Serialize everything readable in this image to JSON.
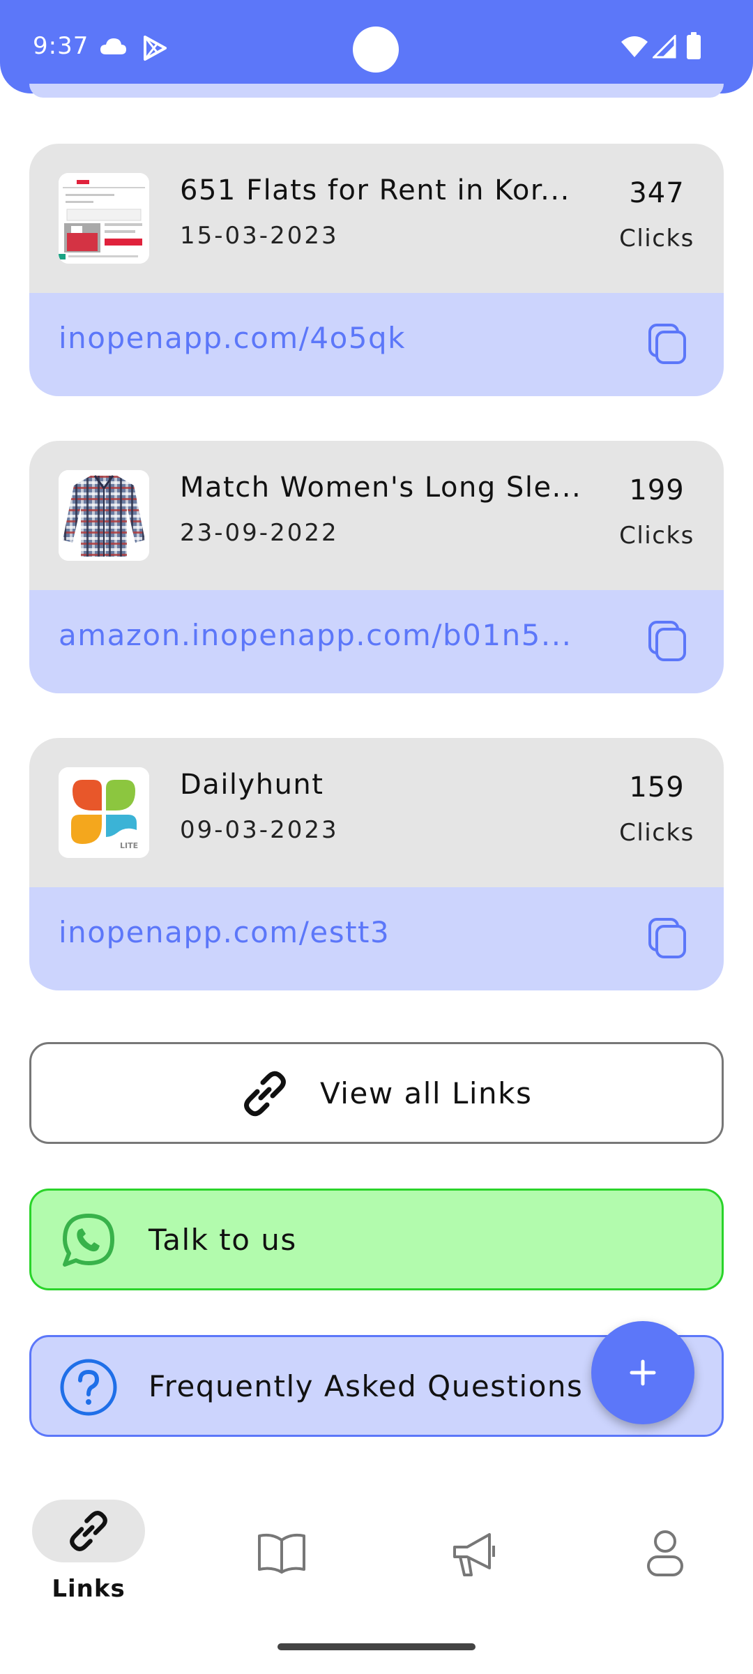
{
  "status_bar": {
    "time": "9:37",
    "icons": [
      "cloud-icon",
      "play-store-icon",
      "wifi-icon",
      "signal-icon",
      "battery-icon"
    ]
  },
  "links": [
    {
      "title": "651   Flats for Rent in Kor...",
      "date": "15-03-2023",
      "clicks": "347",
      "clicks_label": "Clicks",
      "url": "inopenapp.com/4o5qk",
      "thumbnail": "website-screenshot-thumbnail"
    },
    {
      "title": "Match Women's Long Sle...",
      "date": "23-09-2022",
      "clicks": "199",
      "clicks_label": "Clicks",
      "url": "amazon.inopenapp.com/b01n5...",
      "thumbnail": "plaid-shirt-thumbnail"
    },
    {
      "title": "Dailyhunt",
      "date": "09-03-2023",
      "clicks": "159",
      "clicks_label": "Clicks",
      "url": "inopenapp.com/estt3",
      "thumbnail": "dailyhunt-logo-thumbnail"
    }
  ],
  "actions": {
    "view_all": "View all Links",
    "talk": "Talk to us",
    "faq": "Frequently Asked Questions"
  },
  "fab": {
    "icon": "plus-icon"
  },
  "bottom_nav": {
    "active": "Links",
    "items": [
      {
        "label": "Links",
        "icon": "link-icon"
      },
      {
        "icon": "book-icon"
      },
      {
        "icon": "megaphone-icon"
      },
      {
        "icon": "profile-icon"
      }
    ]
  },
  "colors": {
    "primary": "#5c77f9",
    "card_top": "#e5e5e5",
    "card_url_bg": "#ccd4fd",
    "talk_bg": "#b2fbad",
    "talk_border": "#2ad42a",
    "whatsapp": "#38b24a",
    "faq_icon": "#1f6fe8"
  }
}
